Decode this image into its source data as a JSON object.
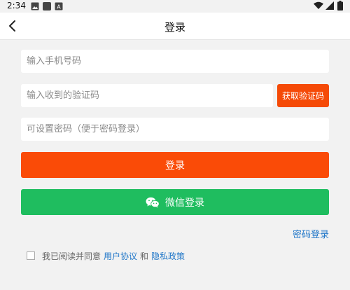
{
  "status_bar": {
    "time": "2:34",
    "icons": [
      "image-icon",
      "app-icon",
      "text-icon",
      "wifi-icon",
      "signal-icon",
      "battery-icon"
    ]
  },
  "nav": {
    "title": "登录",
    "back_icon": "chevron-left-icon"
  },
  "form": {
    "phone_placeholder": "输入手机号码",
    "code_placeholder": "输入收到的验证码",
    "get_code_label": "获取验证码",
    "password_placeholder": "可设置密码（便于密码登录）",
    "login_label": "登录",
    "wechat_login_label": "微信登录",
    "password_login_link": "密码登录"
  },
  "agreement": {
    "prefix": "我已阅读并同意",
    "user_agreement": "用户协议",
    "and": "和",
    "privacy_policy": "隐私政策",
    "checked": false
  },
  "colors": {
    "primary": "#fa4b07",
    "wechat": "#1fbd5f",
    "link": "#1f76c8"
  }
}
